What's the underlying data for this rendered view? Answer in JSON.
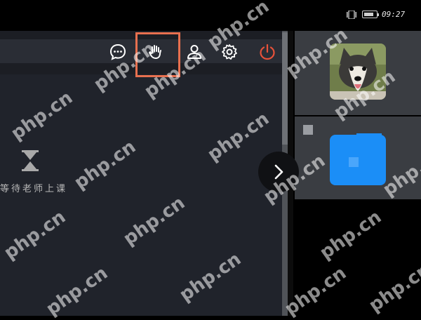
{
  "status_bar": {
    "time": "09:27",
    "signal_icon": "vibrate-icon",
    "battery_icon": "battery-icon"
  },
  "toolbar": {
    "icons": [
      "chat-bubble-icon",
      "raise-hand-icon",
      "person-icon",
      "gear-icon",
      "power-icon"
    ],
    "accent_highlight": "#e8704f",
    "power_color": "#e8523a"
  },
  "main": {
    "waiting_text": "等待老师上课",
    "hourglass_icon": "hourglass-icon"
  },
  "participants": {
    "tile_1": {
      "avatar": "husky-dog-avatar"
    },
    "tile_2": {
      "color": "#1b8ef7"
    }
  },
  "watermark": "php.cn"
}
